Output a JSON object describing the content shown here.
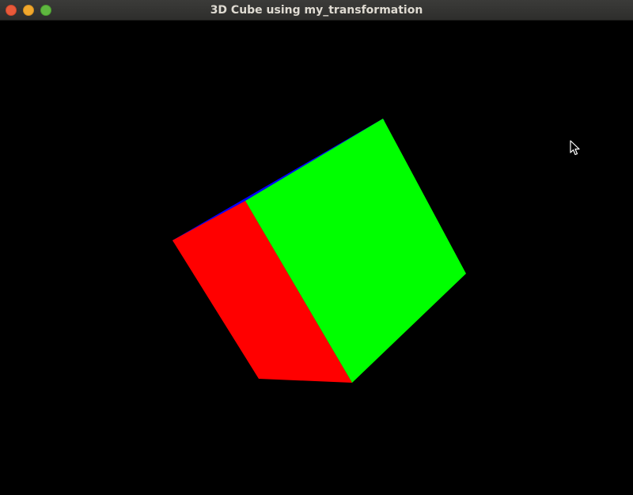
{
  "window": {
    "title": "3D Cube using my_transformation"
  },
  "titlebar_buttons": [
    {
      "name": "close",
      "color": "#e95a3a"
    },
    {
      "name": "minimize",
      "color": "#f1a82d"
    },
    {
      "name": "maximize",
      "color": "#5fb83f"
    }
  ],
  "scene": {
    "background": "#000000",
    "faces": [
      {
        "name": "red-face",
        "color": "#ff0000"
      },
      {
        "name": "green-face",
        "color": "#00ff00"
      },
      {
        "name": "blue-face-edge",
        "color": "#0000ff"
      }
    ]
  },
  "cursor": {
    "icon": "arrow-pointer-icon"
  }
}
